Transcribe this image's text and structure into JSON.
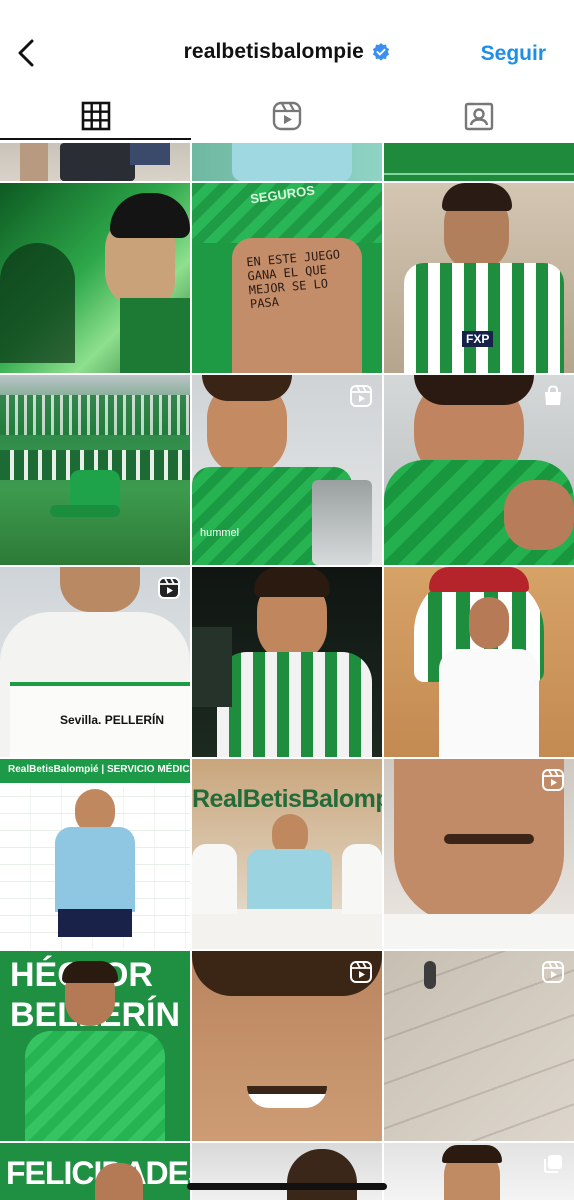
{
  "header": {
    "account_name": "realbetisbalompie",
    "follow_label": "Seguir",
    "accent_color": "#1e8fe8"
  },
  "tabs": [
    {
      "icon": "grid-icon",
      "active": true
    },
    {
      "icon": "reels-icon",
      "active": false
    },
    {
      "icon": "tagged-icon",
      "active": false
    }
  ],
  "posts": [
    {
      "caption": ""
    },
    {
      "caption": "SEGUROS"
    },
    {
      "caption": ""
    },
    {
      "caption": ""
    },
    {
      "caption": "EN ESTE JUEGO GANA EL QUE MEJOR SE LO PASA"
    },
    {
      "caption": "FXP"
    },
    {
      "caption": ""
    },
    {
      "caption": "hummel",
      "badge": "reels-icon"
    },
    {
      "caption": "",
      "badge": "shopping-bag-icon"
    },
    {
      "caption": "Sevilla. PELLERÍN",
      "badge": "reels-icon"
    },
    {
      "caption": ""
    },
    {
      "caption": ""
    },
    {
      "caption": "RealBetisBalompié | SERVICIO MÉDICO OFICIAL"
    },
    {
      "caption": "RealBetisBalompi"
    },
    {
      "caption": "",
      "badge": "reels-icon"
    },
    {
      "caption": "HÉCTOR BELLERÍN"
    },
    {
      "caption": "",
      "badge": "reels-icon"
    },
    {
      "caption": "",
      "badge": "reels-icon"
    },
    {
      "caption": "FELICIDADES"
    },
    {
      "caption": ""
    },
    {
      "caption": "",
      "badge": "carousel-icon"
    }
  ]
}
